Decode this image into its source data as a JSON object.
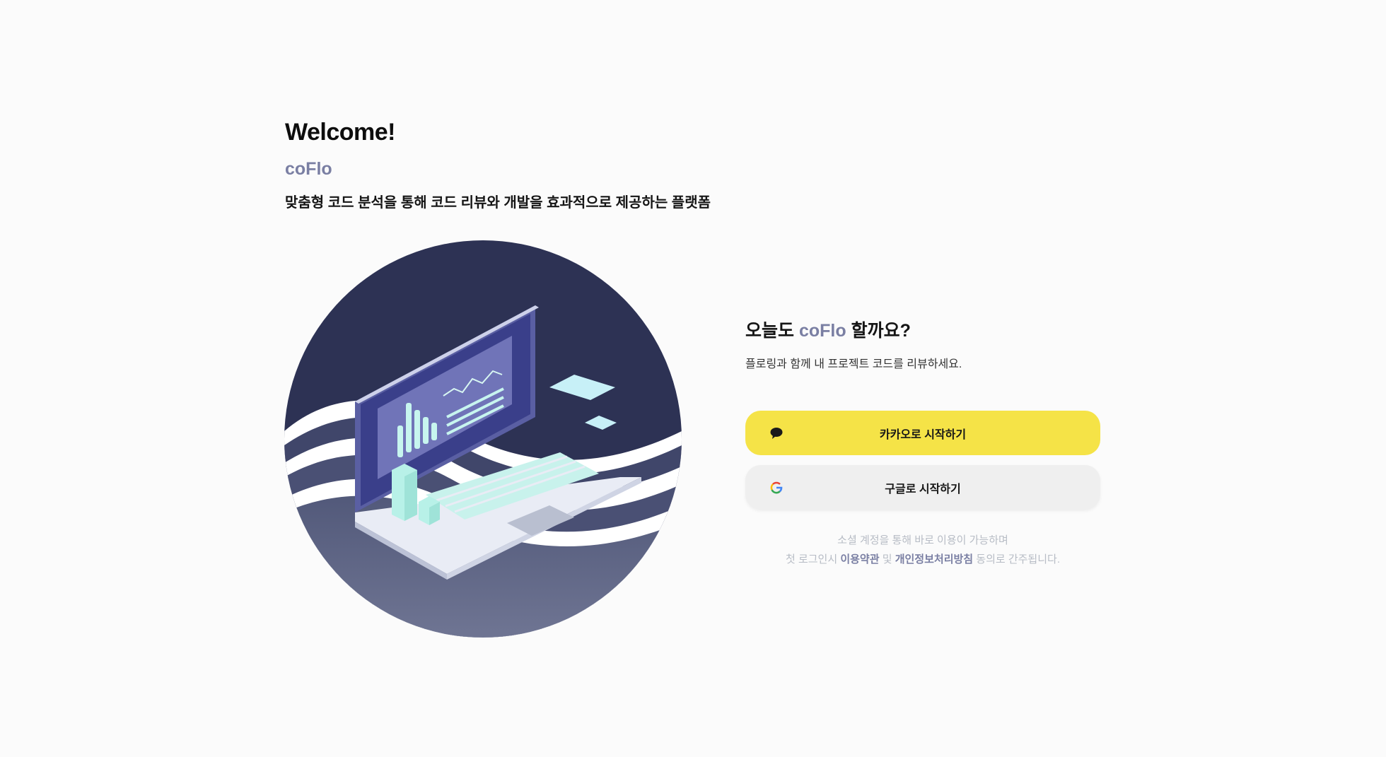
{
  "hero": {
    "title": "Welcome!",
    "brand": "coFlo",
    "description": "맞춤형 코드 분석을 통해 코드 리뷰와 개발을 효과적으로 제공하는 플랫폼"
  },
  "login": {
    "title_prefix": "오늘도",
    "title_brand": "coFlo",
    "title_suffix": "할까요?",
    "subtitle": "플로링과 함께 내 프로젝트 코드를 리뷰하세요.",
    "kakao_label": "카카오로 시작하기",
    "google_label": "구글로 시작하기",
    "notice_line1": "소셜 계정을 통해 바로 이용이 가능하며",
    "notice_line2_prefix": "첫 로그인시",
    "terms_link": "이용약관",
    "and": "및",
    "privacy_link": "개인정보처리방침",
    "notice_line2_suffix": "동의로 간주됩니다."
  },
  "icons": {
    "kakao": "speech-bubble-icon",
    "google": "google-g-icon"
  },
  "colors": {
    "brand": "#7a7fa3",
    "kakao": "#f5e347",
    "google_button": "#efefef",
    "illustration_navy": "#2d3254",
    "notice_text": "#b7bcc5"
  }
}
